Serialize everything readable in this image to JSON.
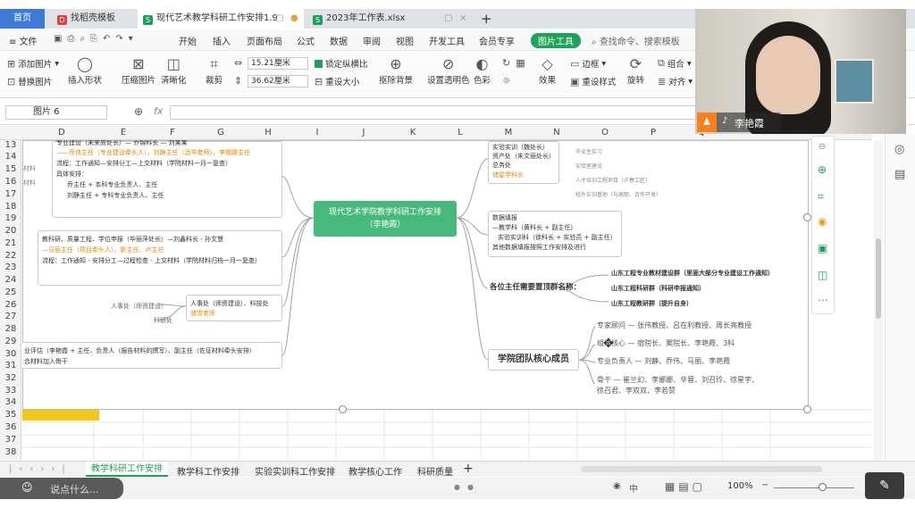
{
  "tabs": [
    {
      "label": "首页"
    },
    {
      "label": "找稻壳模板"
    },
    {
      "label": "现代艺术教学科研工作安排1.9"
    },
    {
      "label": "2023年工作表.xlsx"
    }
  ],
  "menu": {
    "file": "文件",
    "items": [
      "开始",
      "插入",
      "页面布局",
      "公式",
      "数据",
      "审阅",
      "视图",
      "开发工具",
      "会员专享"
    ],
    "picture_tools": "图片工具",
    "search": "查找命令、搜索模板"
  },
  "ribbon": {
    "add_picture": "添加图片",
    "replace_picture": "替换图片",
    "insert_shape": "插入形状",
    "compress": "压缩图片",
    "clarity": "清晰化",
    "crop": "裁剪",
    "width": "15.21厘米",
    "height": "36.62厘米",
    "lock_ratio": "锁定纵横比",
    "reset_size": "重设大小",
    "remove_bg": "抠除背景",
    "set_transparent": "设置透明色",
    "color": "色彩",
    "effect": "效果",
    "reset_style": "重设样式",
    "border": "边框",
    "rotate": "旋转",
    "combine": "组合",
    "align": "对齐"
  },
  "formula": {
    "name_box": "图片 6",
    "fx": "fx"
  },
  "columns": [
    "D",
    "E",
    "F",
    "G",
    "H",
    "I",
    "J",
    "K",
    "L",
    "M",
    "N",
    "O",
    "P",
    "Q"
  ],
  "rows": [
    "13",
    "14",
    "15",
    "16",
    "17",
    "18",
    "19",
    "20",
    "21",
    "22",
    "23",
    "24",
    "25",
    "26",
    "27",
    "28",
    "29",
    "30",
    "31",
    "32",
    "33",
    "34",
    "35",
    "36",
    "37",
    "38"
  ],
  "mindmap": {
    "center": "现代艺术学院教学科研工作安排\n（李艳霞）",
    "l1": [
      "专业建设（未来质处长）— 乔锦科长 — 刘某某",
      "——乔伟主任（专业建设牵头人），刘静主任（远华老师），李娜娜主任",
      "流程：工作通知—安排分工—上交材料（学院材料一月一复查）",
      "具体安排：",
      "乔主任 + 本科专业负责人、主任",
      "刘静主任 + 专科专业负责人、主任"
    ],
    "l2": [
      "教科研、质量工程、学位申报（毕丽萍处长）—刘鑫科长 - 孙文慧",
      "—马丽主任（项目牵头人）、靳主任、卢主任",
      "流程：工作通知 - 安排分工—过程检查 - 上交材料（学院材料归档一月一复查）"
    ],
    "l3": [
      "人事处（师资建设）、科技处",
      "储雪老师"
    ],
    "l3_left": [
      "人事处（师资建设）",
      "科研处"
    ],
    "l4": [
      "业评估（李艳霞 + 主任、负责人（报告材料的撰写）、副主任（佐证材料牵头安排）",
      "合材料加入骨干"
    ],
    "left_edge": [
      "材料",
      "材料"
    ],
    "r1": [
      "实验实训（魏处长）",
      "资产处（朱文丽处长）",
      "总务处",
      "储星学科长"
    ],
    "r1b": [
      "毕业生实习",
      "实验室建设",
      "人才培训工程项目（卢春工匠）",
      "校外实训基地（与高职、合作开发）"
    ],
    "r2": [
      "数据填报",
      "—教学科（黄科长 + 副主任）",
      "实验实训科（徐科长 + 实验员 + 副主任）",
      "其他数据填报按照工作安排及进行"
    ],
    "r3_title": "各位主任需要置顶群名称：",
    "r3": [
      "山东工程专业教材建设群（里面大部分专业建设工作通知）",
      "山东工程科研群（科研申报通知）",
      "山东工程教研群（提升自身）"
    ],
    "r4_title": "学院团队核心成员",
    "r4": [
      {
        "k": "专家顾问",
        "v": "张伟教授、吕在利教授、周长亮教授"
      },
      {
        "k": "组织核心",
        "v": "宿院长、窦院长、李艳霞、3科"
      },
      {
        "k": "专业负责人",
        "v": "刘静、乔伟、马丽、李艳霞"
      },
      {
        "k": "骨干",
        "v": "崔兰幻、李娜娜、辛蓉、刘召玲、徐星宇、\n徐召君、李双双、李若赞"
      }
    ]
  },
  "sheet_tabs": [
    "教学科研工作安排",
    "教学科工作安排",
    "实验实训科工作安排",
    "教学核心工作",
    "科研质量"
  ],
  "status": {
    "zoom": "100%",
    "chat_placeholder": "说点什么...",
    "input": "中"
  },
  "video": {
    "name": "李艳霞"
  }
}
